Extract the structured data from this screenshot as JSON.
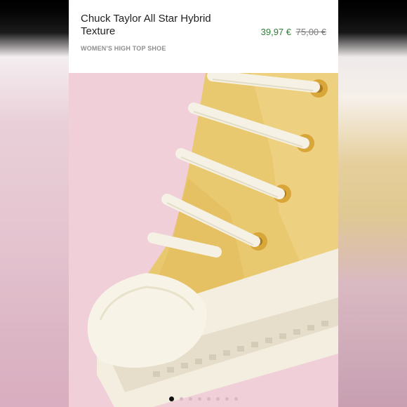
{
  "product": {
    "title": "Chuck Taylor All Star Hybrid Texture",
    "subtitle": "WOMEN'S HIGH TOP SHOE",
    "sale_price": "39,97 €",
    "original_price": "75,00 €"
  },
  "gallery": {
    "image_icon": "sneaker-image",
    "slide_count": 8,
    "active_slide": 1
  },
  "colors": {
    "sale_price": "#2f7d32",
    "background_pink": "#f0cfd9",
    "shoe_yellow": "#e9c96f"
  }
}
